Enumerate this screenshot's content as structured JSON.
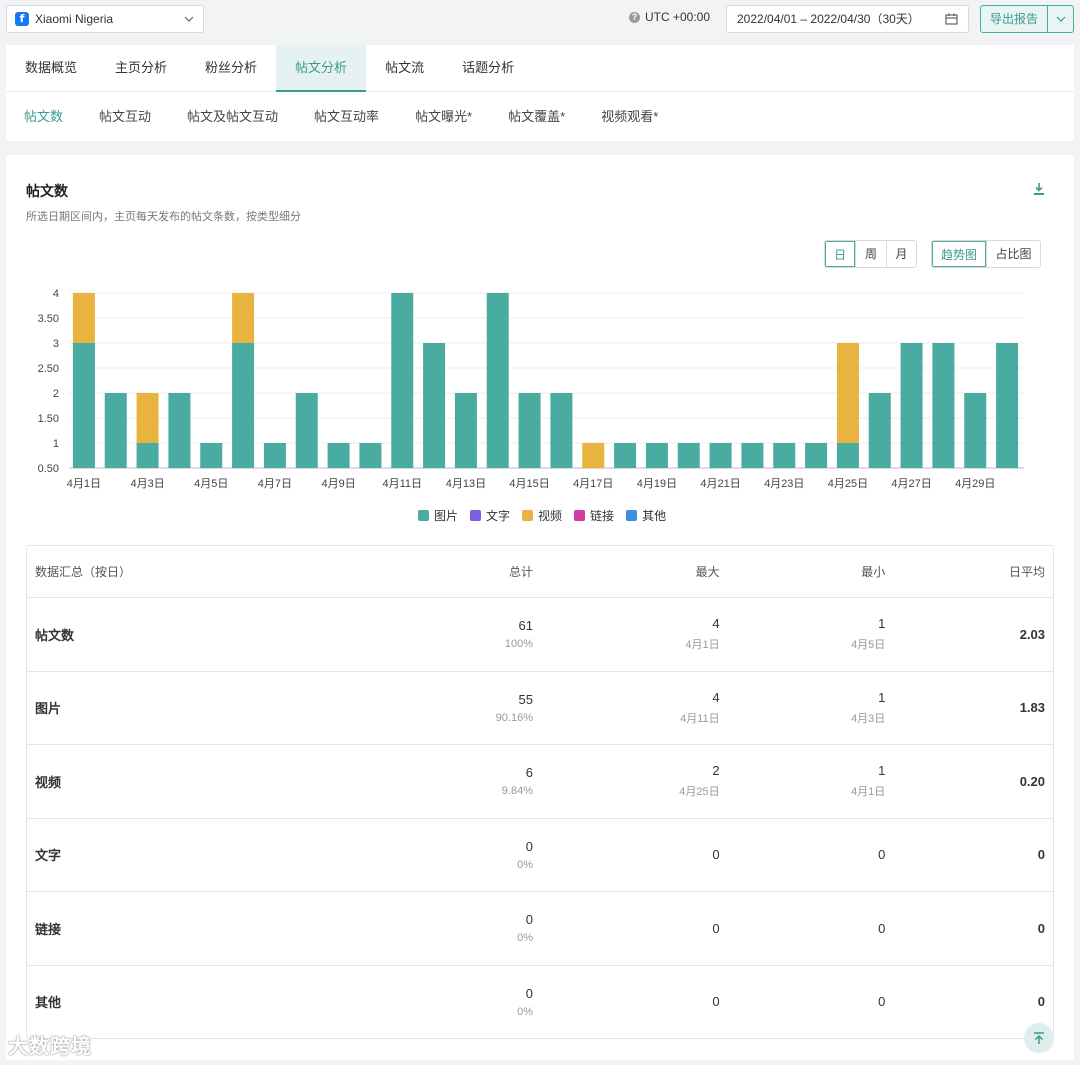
{
  "topbar": {
    "page_name": "Xiaomi Nigeria",
    "timezone": "UTC +00:00",
    "date_range": "2022/04/01 – 2022/04/30（30天）",
    "export_label": "导出报告"
  },
  "tabs_primary": [
    {
      "label": "数据概览"
    },
    {
      "label": "主页分析"
    },
    {
      "label": "粉丝分析"
    },
    {
      "label": "帖文分析",
      "active": true
    },
    {
      "label": "帖文流"
    },
    {
      "label": "话题分析"
    }
  ],
  "tabs_secondary": [
    {
      "label": "帖文数",
      "active": true
    },
    {
      "label": "帖文互动"
    },
    {
      "label": "帖文及帖文互动"
    },
    {
      "label": "帖文互动率"
    },
    {
      "label": "帖文曝光*"
    },
    {
      "label": "帖文覆盖*"
    },
    {
      "label": "视频观看*"
    }
  ],
  "card": {
    "title": "帖文数",
    "subtitle": "所选日期区间内，主页每天发布的帖文条数，按类型细分",
    "granularity": [
      "日",
      "周",
      "月"
    ],
    "granularity_selected": "日",
    "view_modes": [
      "趋势图",
      "占比图"
    ],
    "view_selected": "趋势图"
  },
  "chart_data": {
    "type": "bar",
    "stacked": true,
    "categories": [
      "4月1日",
      "4月2日",
      "4月3日",
      "4月4日",
      "4月5日",
      "4月6日",
      "4月7日",
      "4月8日",
      "4月9日",
      "4月10日",
      "4月11日",
      "4月12日",
      "4月13日",
      "4月14日",
      "4月15日",
      "4月16日",
      "4月17日",
      "4月18日",
      "4月19日",
      "4月20日",
      "4月21日",
      "4月22日",
      "4月23日",
      "4月24日",
      "4月25日",
      "4月26日",
      "4月27日",
      "4月28日",
      "4月29日",
      "4月30日"
    ],
    "tick_labels": [
      "4月1日",
      "4月3日",
      "4月5日",
      "4月7日",
      "4月9日",
      "4月11日",
      "4月13日",
      "4月15日",
      "4月17日",
      "4月19日",
      "4月21日",
      "4月23日",
      "4月25日",
      "4月27日",
      "4月29日"
    ],
    "y_ticks": [
      "0.50",
      "1",
      "1.50",
      "2",
      "2.50",
      "3",
      "3.50",
      "4"
    ],
    "ylim": [
      0.5,
      4
    ],
    "series": [
      {
        "name": "图片",
        "color": "#4aaba0",
        "values": [
          3,
          2,
          1,
          2,
          1,
          3,
          1,
          2,
          1,
          1,
          4,
          3,
          2,
          4,
          2,
          2,
          0,
          1,
          1,
          1,
          1,
          1,
          1,
          1,
          1,
          2,
          3,
          3,
          2,
          3
        ]
      },
      {
        "name": "文字",
        "color": "#7b5fe0",
        "values": [
          0,
          0,
          0,
          0,
          0,
          0,
          0,
          0,
          0,
          0,
          0,
          0,
          0,
          0,
          0,
          0,
          0,
          0,
          0,
          0,
          0,
          0,
          0,
          0,
          0,
          0,
          0,
          0,
          0,
          0
        ]
      },
      {
        "name": "视频",
        "color": "#e8b33f",
        "values": [
          1,
          0,
          1,
          0,
          0,
          1,
          0,
          0,
          0,
          0,
          0,
          0,
          0,
          0,
          0,
          0,
          1,
          0,
          0,
          0,
          0,
          0,
          0,
          0,
          2,
          0,
          0,
          0,
          0,
          0
        ]
      },
      {
        "name": "链接",
        "color": "#d63ba5",
        "values": [
          0,
          0,
          0,
          0,
          0,
          0,
          0,
          0,
          0,
          0,
          0,
          0,
          0,
          0,
          0,
          0,
          0,
          0,
          0,
          0,
          0,
          0,
          0,
          0,
          0,
          0,
          0,
          0,
          0,
          0
        ]
      },
      {
        "name": "其他",
        "color": "#3d8fdc",
        "values": [
          0,
          0,
          0,
          0,
          0,
          0,
          0,
          0,
          0,
          0,
          0,
          0,
          0,
          0,
          0,
          0,
          0,
          0,
          0,
          0,
          0,
          0,
          0,
          0,
          0,
          0,
          0,
          0,
          0,
          0
        ]
      }
    ],
    "grid": true,
    "legend_position": "bottom-center"
  },
  "table": {
    "headers": [
      "数据汇总（按日）",
      "总计",
      "最大",
      "最小",
      "日平均"
    ],
    "rows": [
      {
        "name": "帖文数",
        "total": "61",
        "total_pct": "100%",
        "max": "4",
        "max_date": "4月1日",
        "min": "1",
        "min_date": "4月5日",
        "avg": "2.03"
      },
      {
        "name": "图片",
        "total": "55",
        "total_pct": "90.16%",
        "max": "4",
        "max_date": "4月11日",
        "min": "1",
        "min_date": "4月3日",
        "avg": "1.83"
      },
      {
        "name": "视频",
        "total": "6",
        "total_pct": "9.84%",
        "max": "2",
        "max_date": "4月25日",
        "min": "1",
        "min_date": "4月1日",
        "avg": "0.20"
      },
      {
        "name": "文字",
        "total": "0",
        "total_pct": "0%",
        "max": "0",
        "max_date": "",
        "min": "0",
        "min_date": "",
        "avg": "0"
      },
      {
        "name": "链接",
        "total": "0",
        "total_pct": "0%",
        "max": "0",
        "max_date": "",
        "min": "0",
        "min_date": "",
        "avg": "0"
      },
      {
        "name": "其他",
        "total": "0",
        "total_pct": "0%",
        "max": "0",
        "max_date": "",
        "min": "0",
        "min_date": "",
        "avg": "0"
      }
    ]
  },
  "watermark": "大数跨境"
}
